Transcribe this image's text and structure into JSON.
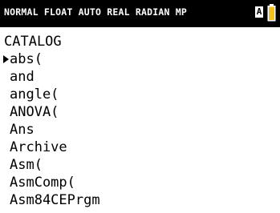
{
  "status_bar": {
    "text": "NORMAL FLOAT AUTO REAL RADIAN MP",
    "alpha_indicator": "A",
    "battery_icon": "battery-icon",
    "battery_color": "#f0c020"
  },
  "catalog": {
    "title": "CATALOG",
    "cursor_icon": "cursor-triangle-icon",
    "items": [
      {
        "label": "abs("
      },
      {
        "label": "and"
      },
      {
        "label": "angle("
      },
      {
        "label": "ANOVA("
      },
      {
        "label": "Ans"
      },
      {
        "label": "Archive"
      },
      {
        "label": "Asm("
      },
      {
        "label": "AsmComp("
      },
      {
        "label": "Asm84CEPrgm"
      }
    ]
  }
}
